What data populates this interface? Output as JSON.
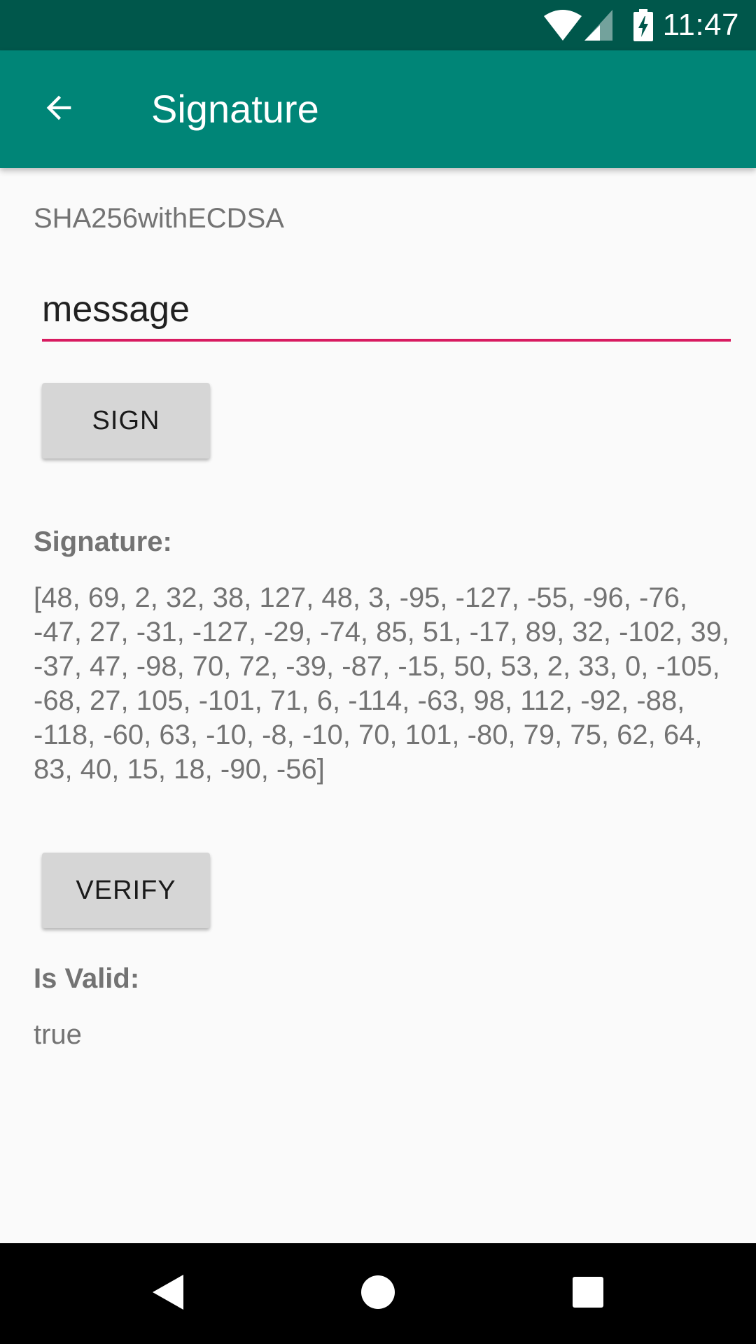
{
  "status_bar": {
    "time": "11:47",
    "icons": [
      "wifi-icon",
      "signal-icon",
      "battery-charging-icon"
    ]
  },
  "app_bar": {
    "title": "Signature",
    "back_icon": "arrow-back-icon"
  },
  "content": {
    "algorithm": "SHA256withECDSA",
    "message_value": "message",
    "sign_label": "SIGN",
    "signature_label": "Signature:",
    "signature_value": "[48, 69, 2, 32, 38, 127, 48, 3, -95, -127, -55, -96, -76, -47, 27, -31, -127, -29, -74, 85, 51, -17, 89, 32, -102, 39, -37, 47, -98, 70, 72, -39, -87, -15, 50, 53, 2, 33, 0, -105, -68, 27, 105, -101, 71, 6, -114, -63, 98, 112, -92, -88, -118, -60, 63, -10, -8, -10, 70, 101, -80, 79, 75, 62, 64, 83, 40, 15, 18, -90, -56]",
    "verify_label": "VERIFY",
    "is_valid_label": "Is Valid:",
    "is_valid_value": "true"
  },
  "nav_bar": {
    "icons": [
      "nav-back-icon",
      "nav-home-icon",
      "nav-recents-icon"
    ]
  },
  "colors": {
    "status_bar": "#00574b",
    "app_bar": "#008577",
    "accent": "#d81b60",
    "button": "#d6d6d6",
    "background": "#fafafa"
  }
}
